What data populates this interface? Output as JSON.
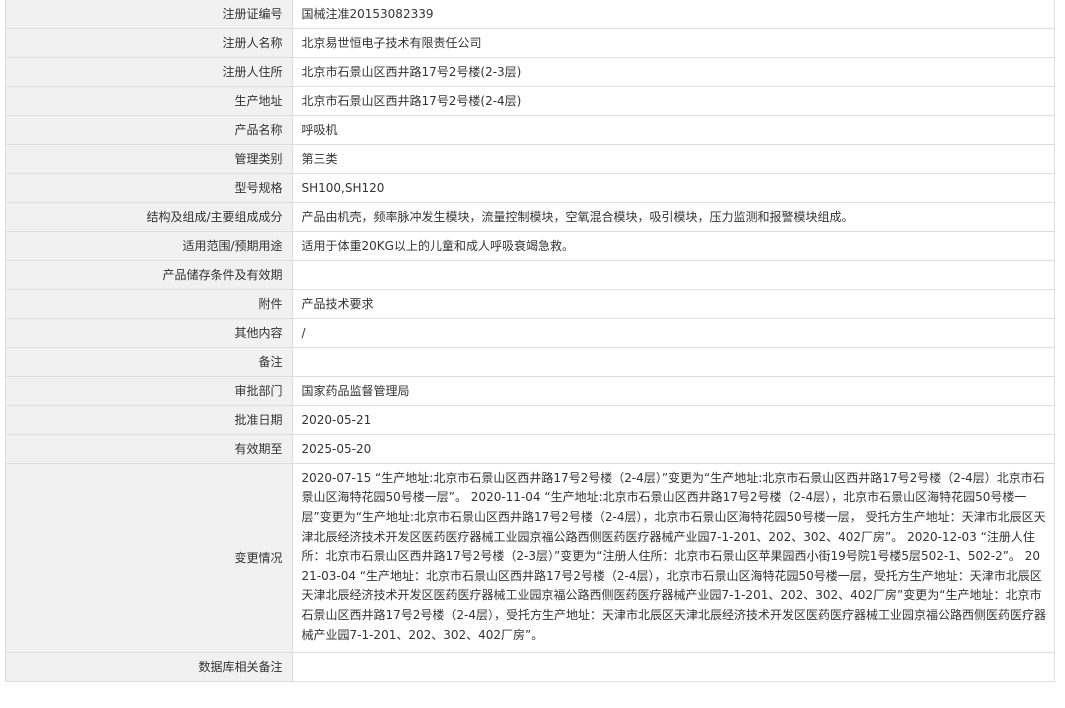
{
  "rows": [
    {
      "label": "注册证编号",
      "value": "国械注准20153082339"
    },
    {
      "label": "注册人名称",
      "value": "北京易世恒电子技术有限责任公司"
    },
    {
      "label": "注册人住所",
      "value": "北京市石景山区西井路17号2号楼(2-3层)"
    },
    {
      "label": "生产地址",
      "value": "北京市石景山区西井路17号2号楼(2-4层)"
    },
    {
      "label": "产品名称",
      "value": "呼吸机"
    },
    {
      "label": "管理类别",
      "value": "第三类"
    },
    {
      "label": "型号规格",
      "value": "SH100,SH120"
    },
    {
      "label": "结构及组成/主要组成成分",
      "value": "产品由机壳，频率脉冲发生模块，流量控制模块，空氧混合模块，吸引模块，压力监测和报警模块组成。"
    },
    {
      "label": "适用范围/预期用途",
      "value": "适用于体重20KG以上的儿童和成人呼吸衰竭急救。"
    },
    {
      "label": "产品储存条件及有效期",
      "value": ""
    },
    {
      "label": "附件",
      "value": "产品技术要求"
    },
    {
      "label": "其他内容",
      "value": "/"
    },
    {
      "label": "备注",
      "value": ""
    },
    {
      "label": "审批部门",
      "value": "国家药品监督管理局"
    },
    {
      "label": "批准日期",
      "value": "2020-05-21"
    },
    {
      "label": "有效期至",
      "value": "2025-05-20"
    },
    {
      "label": "变更情况",
      "value": "2020-07-15 “生产地址:北京市石景山区西井路17号2号楼（2-4层）”变更为“生产地址:北京市石景山区西井路17号2号楼（2-4层）北京市石景山区海特花园50号楼一层”。 2020-11-04 “生产地址:北京市石景山区西井路17号2号楼（2-4层），北京市石景山区海特花园50号楼一层”变更为“生产地址:北京市石景山区西井路17号2号楼（2-4层），北京市石景山区海特花园50号楼一层， 受托方生产地址：天津市北辰区天津北辰经济技术开发区医药医疗器械工业园京福公路西侧医药医疗器械产业园7-1-201、202、302、402厂房”。 2020-12-03 “注册人住所：北京市石景山区西井路17号2号楼（2-3层）”变更为“注册人住所：北京市石景山区苹果园西小街19号院1号楼5层502-1、502-2”。 2021-03-04 “生产地址：北京市石景山区西井路17号2号楼（2-4层），北京市石景山区海特花园50号楼一层，受托方生产地址：天津市北辰区天津北辰经济技术开发区医药医疗器械工业园京福公路西侧医药医疗器械产业园7-1-201、202、302、402厂房”变更为“生产地址：北京市石景山区西井路17号2号楼（2-4层），受托方生产地址：天津市北辰区天津北辰经济技术开发区医药医疗器械工业园京福公路西侧医药医疗器械产业园7-1-201、202、302、402厂房”。"
    },
    {
      "label": "数据库相关备注",
      "value": ""
    }
  ]
}
